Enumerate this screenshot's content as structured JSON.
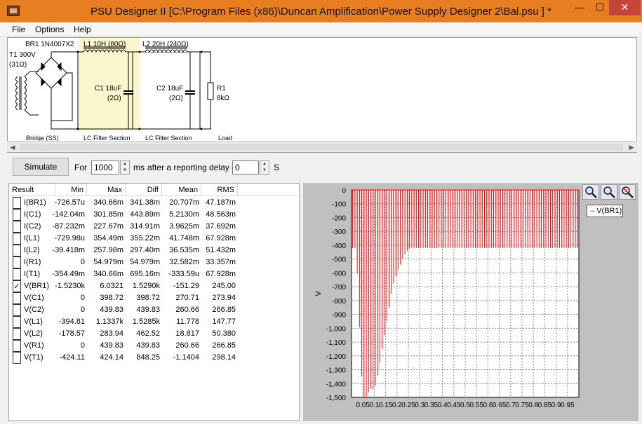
{
  "window": {
    "title": "PSU Designer II  [C:\\Program Files (x86)\\Duncan Amplification\\Power Supply Designer 2\\Bal.psu ] *",
    "minimize": "—",
    "maximize": "☐",
    "close": "✕"
  },
  "menu": [
    "File",
    "Options",
    "Help"
  ],
  "schematic": {
    "br1": "BR1 1N4007X2",
    "l1": "L1 10H (80Ω)",
    "l2": "L2 20H (240Ω)",
    "t1a": "T1 300V",
    "t1b": "(31Ω)",
    "c1a": "C1 18uF",
    "c1b": "(2Ω)",
    "c2a": "C2 18uF",
    "c2b": "(2Ω)",
    "r1a": "R1",
    "r1b": "8kΩ",
    "sec_bridge": "Bridge (SS)",
    "sec_lc1": "LC Filter Section",
    "sec_lc2": "LC Filter Section",
    "sec_load": "Load"
  },
  "controls": {
    "simulate": "Simulate",
    "for_label": "For",
    "duration": "1000",
    "ms_label": "ms",
    "delay_label": "after a reporting delay of",
    "delay": "0",
    "s_label": "S"
  },
  "table": {
    "headers": [
      "Result",
      "Min",
      "Max",
      "Diff",
      "Mean",
      "RMS"
    ],
    "rows": [
      {
        "name": "I(BR1)",
        "checked": "",
        "min": "-726.57u",
        "max": "340.66m",
        "diff": "341.38m",
        "mean": "20.707m",
        "rms": "47.187m"
      },
      {
        "name": "I(C1)",
        "checked": "",
        "min": "-142.04m",
        "max": "301.85m",
        "diff": "443.89m",
        "mean": "5.2130m",
        "rms": "48.563m"
      },
      {
        "name": "I(C2)",
        "checked": "",
        "min": "-87.232m",
        "max": "227.67m",
        "diff": "314.91m",
        "mean": "3.9625m",
        "rms": "37.692m"
      },
      {
        "name": "I(L1)",
        "checked": "",
        "min": "-729.98u",
        "max": "354.49m",
        "diff": "355.22m",
        "mean": "41.748m",
        "rms": "67.928m"
      },
      {
        "name": "I(L2)",
        "checked": "",
        "min": "-39.418m",
        "max": "257.98m",
        "diff": "297.40m",
        "mean": "36.535m",
        "rms": "51.432m"
      },
      {
        "name": "I(R1)",
        "checked": "",
        "min": "0",
        "max": "54.979m",
        "diff": "54.979m",
        "mean": "32.582m",
        "rms": "33.357m"
      },
      {
        "name": "I(T1)",
        "checked": "",
        "min": "-354.49m",
        "max": "340.66m",
        "diff": "695.16m",
        "mean": "-333.59u",
        "rms": "67.928m"
      },
      {
        "name": "V(BR1)",
        "checked": "✓",
        "min": "-1.5230k",
        "max": "6.0321",
        "diff": "1.5290k",
        "mean": "-151.29",
        "rms": "245.00"
      },
      {
        "name": "V(C1)",
        "checked": "",
        "min": "0",
        "max": "398.72",
        "diff": "398.72",
        "mean": "270.71",
        "rms": "273.94"
      },
      {
        "name": "V(C2)",
        "checked": "",
        "min": "0",
        "max": "439.83",
        "diff": "439.83",
        "mean": "260.66",
        "rms": "266.85"
      },
      {
        "name": "V(L1)",
        "checked": "",
        "min": "-394.81",
        "max": "1.1337k",
        "diff": "1.5285k",
        "mean": "11.778",
        "rms": "147.77"
      },
      {
        "name": "V(L2)",
        "checked": "",
        "min": "-178.57",
        "max": "283.94",
        "diff": "462.52",
        "mean": "18.817",
        "rms": "50.380"
      },
      {
        "name": "V(R1)",
        "checked": "",
        "min": "0",
        "max": "439.83",
        "diff": "439.83",
        "mean": "260.66",
        "rms": "266.85"
      },
      {
        "name": "V(T1)",
        "checked": "",
        "min": "-424.11",
        "max": "424.14",
        "diff": "848.25",
        "mean": "-1.1404",
        "rms": "298.14"
      }
    ]
  },
  "chart_data": {
    "type": "line",
    "title": "",
    "xlabel": "",
    "ylabel": "V",
    "xlim": [
      0,
      1.0
    ],
    "ylim": [
      -1500,
      0
    ],
    "grid": true,
    "legend": "top-right",
    "y_ticks": [
      "0",
      "-100",
      "-200",
      "-300",
      "-400",
      "-500",
      "-600",
      "-700",
      "-800",
      "-900",
      "-1,000",
      "-1,100",
      "-1,200",
      "-1,300",
      "-1,400",
      "-1,500"
    ],
    "x_ticks": [
      "0.05",
      "0.1",
      "0.15",
      "0.2",
      "0.25",
      "0.3",
      "0.35",
      "0.4",
      "0.45",
      "0.5",
      "0.55",
      "0.6",
      "0.65",
      "0.7",
      "0.75",
      "0.8",
      "0.85",
      "0.9",
      "0.95"
    ],
    "series": [
      {
        "name": "V(BR1)",
        "color": "#ff0000",
        "x": [
          0,
          0.02,
          0.03,
          0.04,
          0.05,
          0.06,
          0.07,
          0.08,
          0.09,
          0.1,
          0.11,
          0.12,
          0.13,
          0.14,
          0.15,
          0.16,
          0.17,
          0.18,
          0.19,
          0.2,
          0.21,
          0.22,
          0.23,
          0.24,
          0.25,
          0.26,
          0.27,
          0.28,
          0.29,
          0.3,
          0.35,
          0.4,
          0.5,
          0.6,
          0.7,
          0.8,
          0.9,
          1.0
        ],
        "peak_min": [
          -420,
          -420,
          -790,
          -1200,
          -1500,
          -1510,
          -1480,
          -1450,
          -1430,
          -1450,
          -1380,
          -1300,
          -1200,
          -1100,
          -1000,
          -900,
          -800,
          -700,
          -650,
          -600,
          -560,
          -520,
          -480,
          -450,
          -430,
          -420,
          -420,
          -420,
          -420,
          -420,
          -420,
          -420,
          -420,
          -420,
          -420,
          -420,
          -420,
          -420
        ]
      }
    ]
  }
}
